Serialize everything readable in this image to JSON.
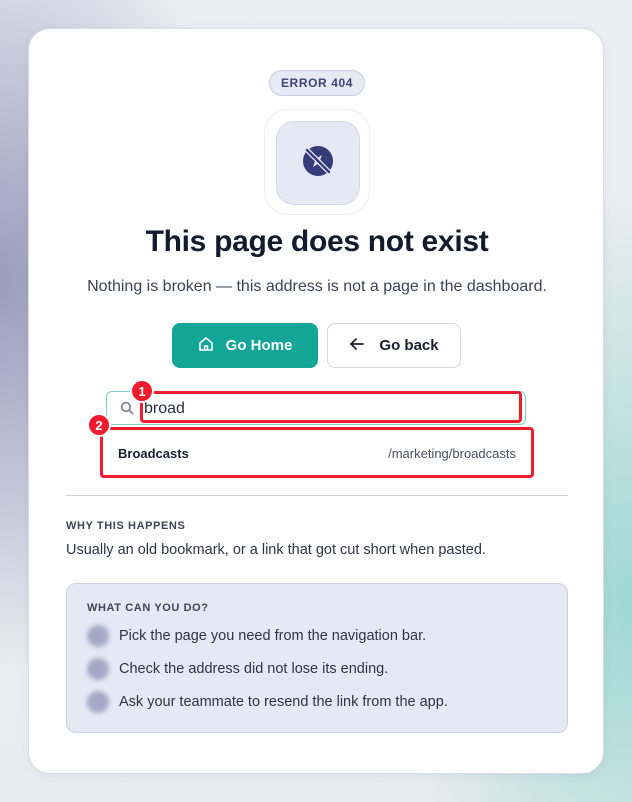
{
  "badge": "ERROR 404",
  "title": "This page does not exist",
  "subtitle": "Nothing is broken — this address is not a page in the dashboard.",
  "buttons": {
    "home": "Go Home",
    "back": "Go back"
  },
  "search": {
    "value": "broad"
  },
  "result": {
    "name": "Broadcasts",
    "path": "/marketing/broadcasts"
  },
  "annotations": [
    "1",
    "2"
  ],
  "why": {
    "heading": "WHY THIS HAPPENS",
    "text": "Usually an old bookmark, or a link that got cut short when pasted."
  },
  "help": {
    "heading": "WHAT CAN YOU DO?",
    "steps": [
      "Pick the page you need from the navigation bar.",
      "Check the address did not lose its ending.",
      "Ask your teammate to resend the link from the app."
    ]
  },
  "colors": {
    "accent": "#13a595",
    "annotation": "#ef1c2e",
    "badge_bg": "#e7e9f4",
    "icon_color": "#353c78"
  },
  "icons": {
    "status": "compass-off-icon",
    "home": "home-icon",
    "back": "arrow-left-icon",
    "search": "search-icon"
  }
}
